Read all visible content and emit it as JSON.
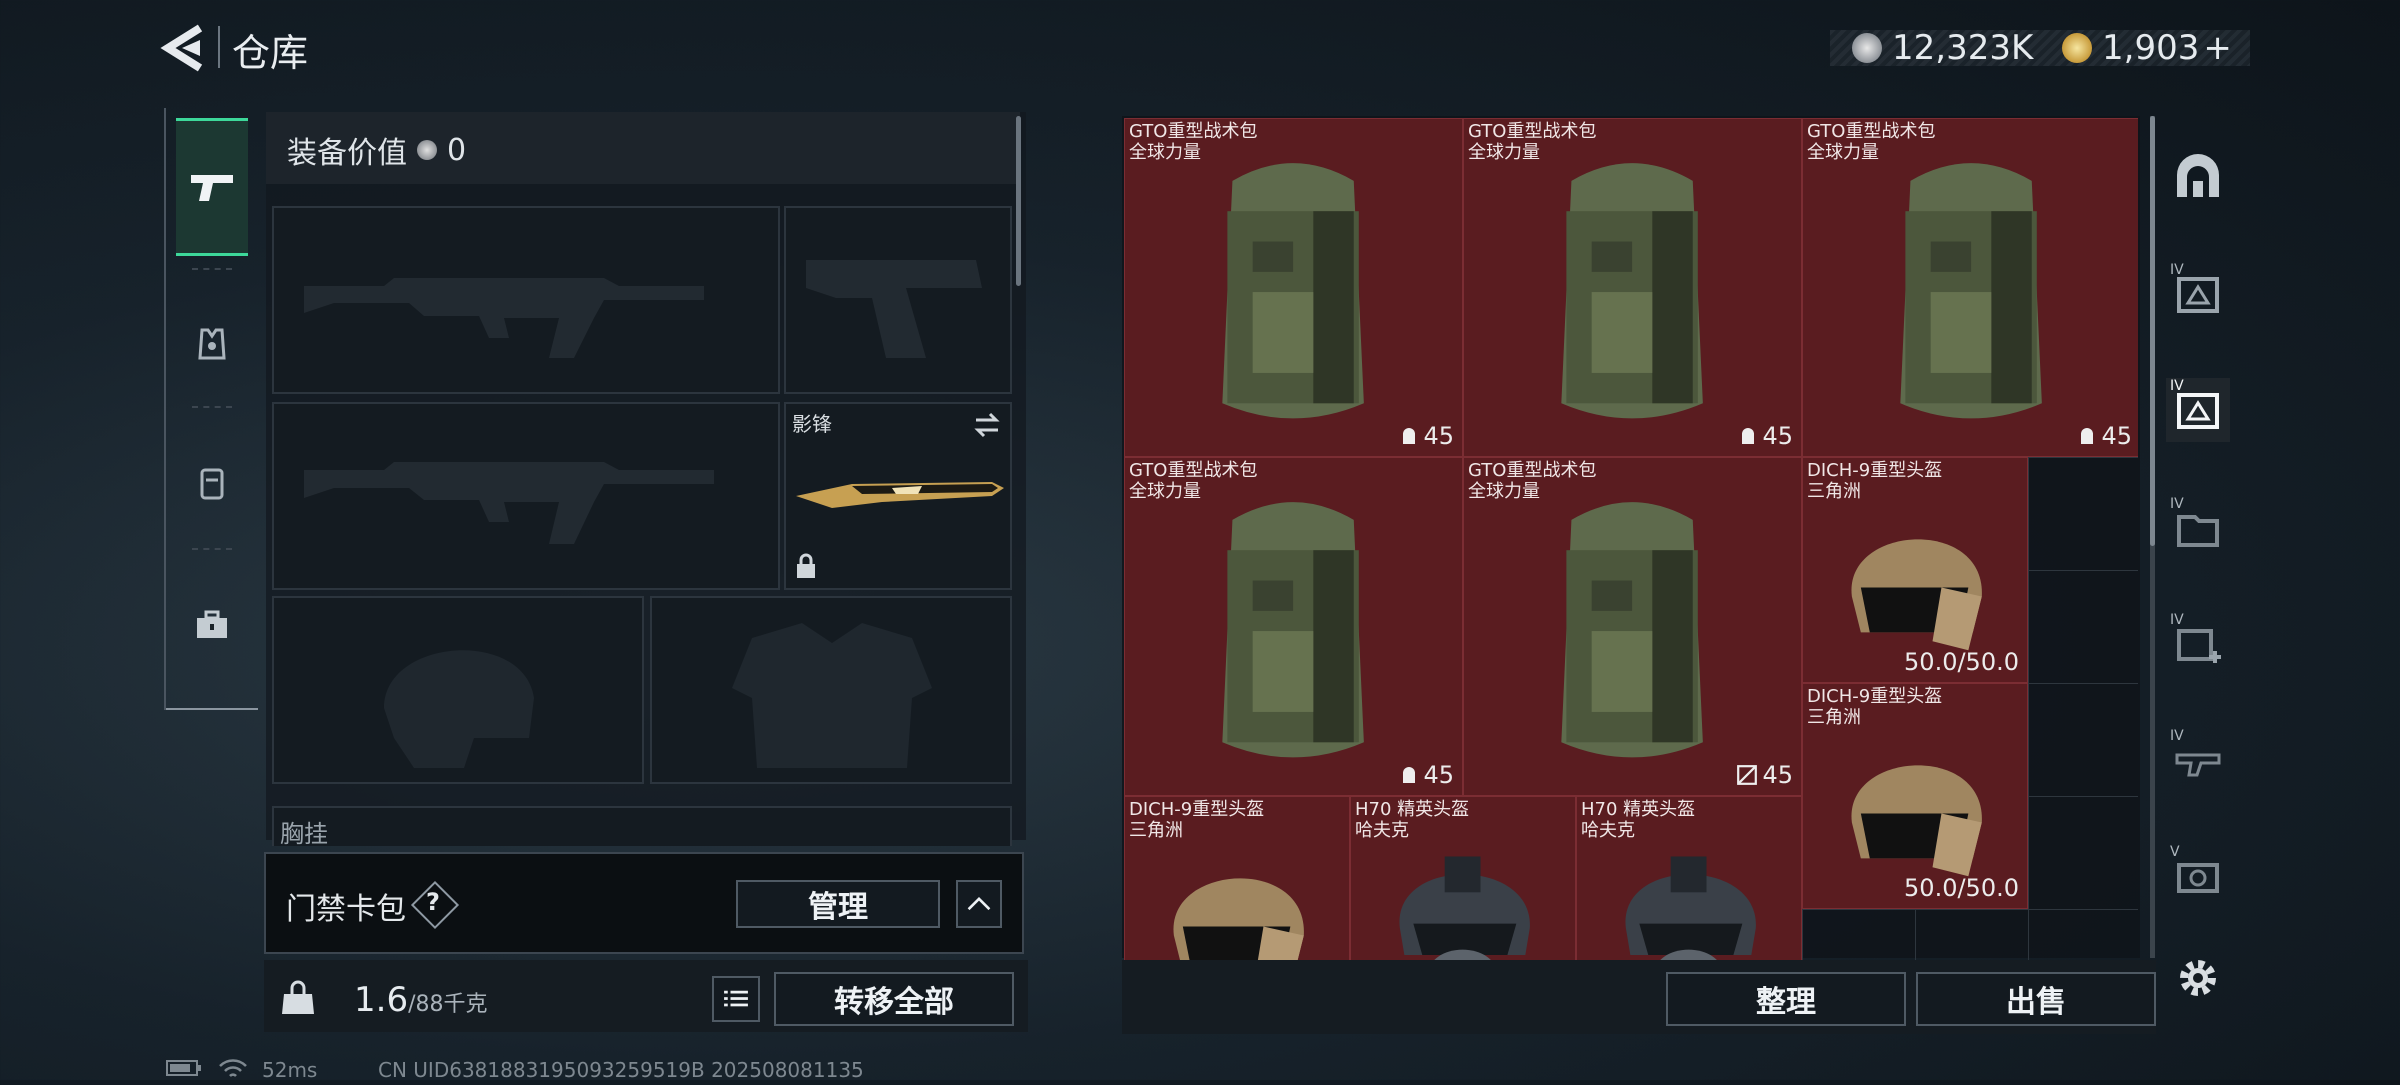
{
  "header": {
    "title": "仓库",
    "currency_silver": "12,323K",
    "currency_gold": "1,903",
    "currency_add": "+"
  },
  "equipment": {
    "value_label": "装备价值",
    "value_amount": "0",
    "melee_label": "影锋",
    "next_label": "胸挂"
  },
  "card_pack": {
    "label": "门禁卡包",
    "help": "?",
    "manage_button": "管理"
  },
  "bottom_left": {
    "weight_current": "1.6",
    "weight_max": "/88千克",
    "transfer_all_button": "转移全部"
  },
  "status_bar": {
    "ping": "52ms",
    "uid": "CN UID6381883195093259519B 202508081135"
  },
  "grid_items": [
    {
      "name": "GTO重型战术包",
      "sub": "全球力量",
      "badge": "45"
    },
    {
      "name": "GTO重型战术包",
      "sub": "全球力量",
      "badge": "45"
    },
    {
      "name": "GTO重型战术包",
      "sub": "全球力量",
      "badge": "45"
    },
    {
      "name": "GTO重型战术包",
      "sub": "全球力量",
      "badge": "45"
    },
    {
      "name": "GTO重型战术包",
      "sub": "全球力量",
      "badge": "45"
    },
    {
      "name": "DICH-9重型头盔",
      "sub": "三角洲",
      "badge": "50.0/50.0"
    },
    {
      "name": "DICH-9重型头盔",
      "sub": "三角洲",
      "badge": "50.0/50.0"
    },
    {
      "name": "DICH-9重型头盔",
      "sub": "三角洲",
      "badge": ""
    },
    {
      "name": "H70 精英头盔",
      "sub": "哈夫克",
      "badge": ""
    },
    {
      "name": "H70 精英头盔",
      "sub": "哈夫克",
      "badge": ""
    }
  ],
  "grid_actions": {
    "sort_button": "整理",
    "sell_button": "出售"
  },
  "right_nav": {
    "tab_labels": [
      "IV",
      "IV",
      "IV",
      "IV",
      "IV",
      "V"
    ]
  },
  "colors": {
    "accent_green": "#3dd89a",
    "item_bg": "#5a1c20"
  }
}
